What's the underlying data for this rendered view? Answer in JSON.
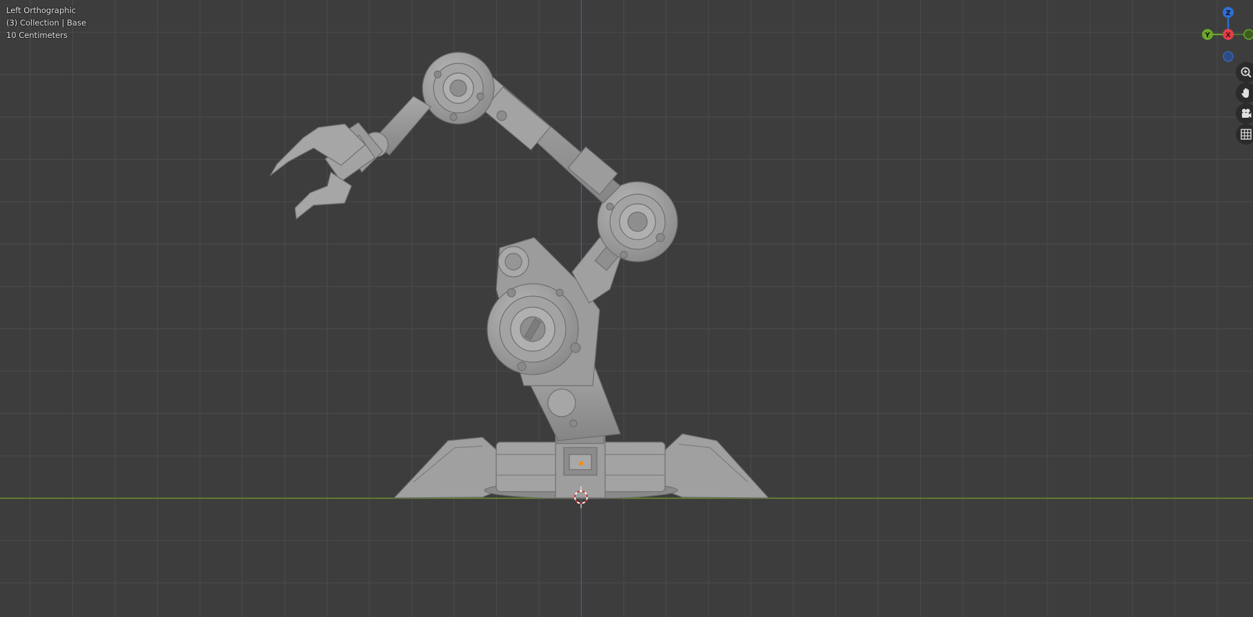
{
  "viewport": {
    "view_name": "Left Orthographic",
    "collection_info": "(3) Collection | Base",
    "grid_scale": "10 Centimeters",
    "colors": {
      "background": "#3d3d3d",
      "grid": "#4d4d4d",
      "horizon_axis": "#6f8f2e",
      "vertical_axis": "#4a5ca8",
      "model": "#9a9a9a",
      "origin_dot": "#ff8a00"
    }
  },
  "gizmo": {
    "axes": [
      {
        "label": "Z",
        "color": "#2f6fd6"
      },
      {
        "label": "Y",
        "color": "#6aa82c"
      },
      {
        "label": "X",
        "color": "#e0404a"
      }
    ]
  },
  "nav_buttons": [
    {
      "icon": "zoom-icon"
    },
    {
      "icon": "pan-hand-icon"
    },
    {
      "icon": "camera-icon"
    },
    {
      "icon": "grid-icon"
    }
  ]
}
